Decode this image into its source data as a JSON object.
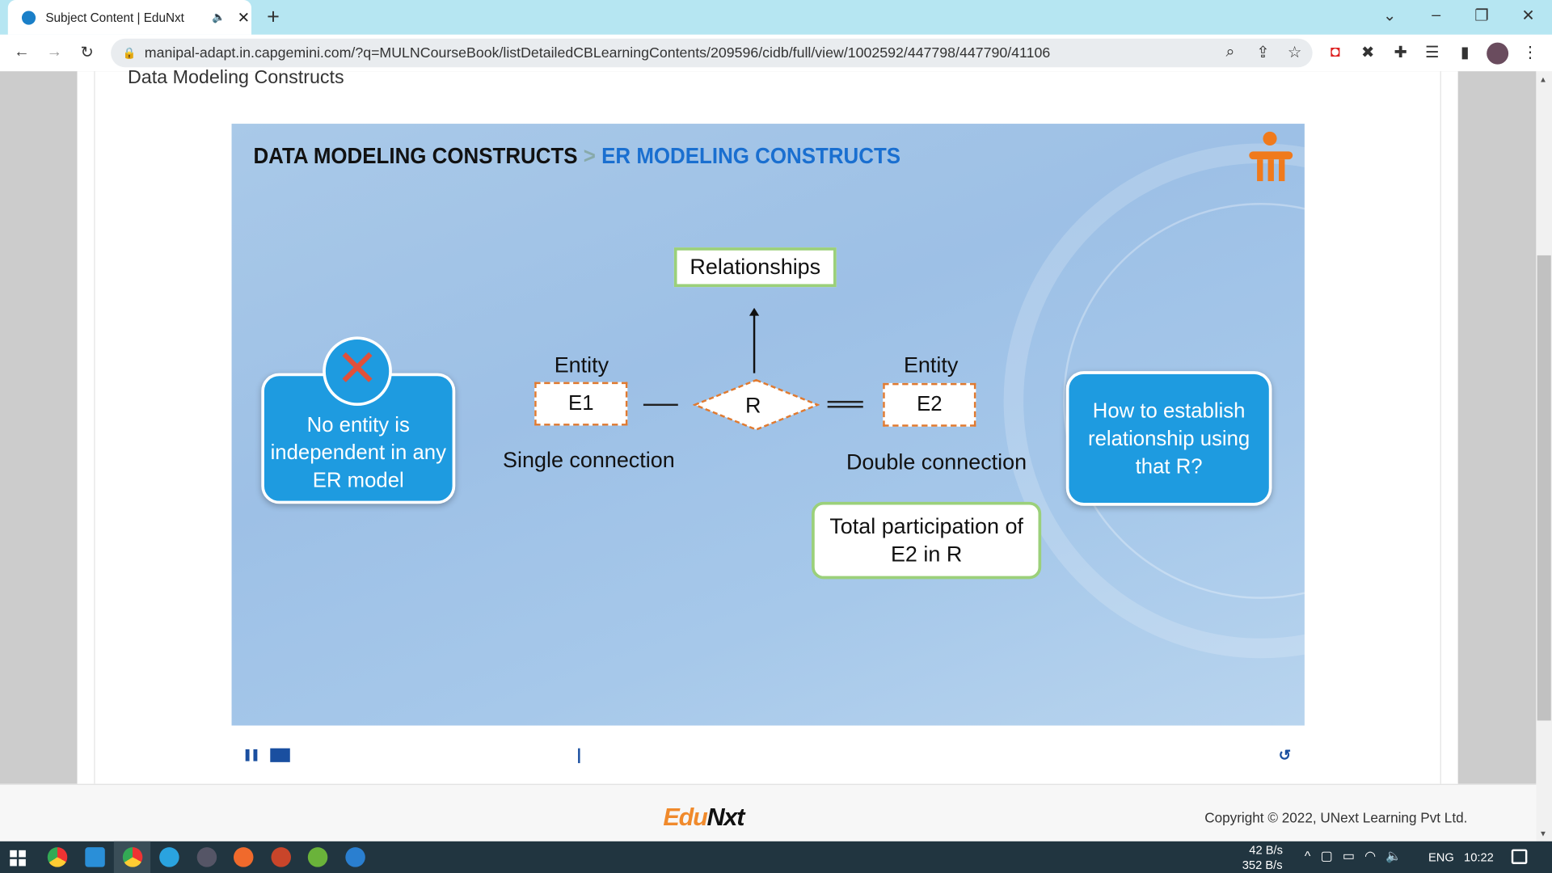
{
  "browser": {
    "tab_title": "Subject Content | EduNxt",
    "url": "manipal-adapt.in.capgemini.com/?q=MULNCourseBook/listDetailedCBLearningContents/209596/cidb/full/view/1002592/447798/447790/41106"
  },
  "page": {
    "heading": "Data Modeling Constructs"
  },
  "slide": {
    "breadcrumb_main": "DATA MODELING CONSTRUCTS",
    "breadcrumb_sep": ">",
    "breadcrumb_sub": "ER MODELING CONSTRUCTS",
    "left_note": "No entity is independent in any ER model",
    "relationships_label": "Relationships",
    "entity1_caption": "Entity",
    "entity1": "E1",
    "relationship": "R",
    "entity2_caption": "Entity",
    "entity2": "E2",
    "single_connection": "Single connection",
    "double_connection": "Double connection",
    "total_participation": "Total participation of E2 in R",
    "right_note": "How to establish relationship using that R?"
  },
  "player": {
    "progress_percent": 0
  },
  "footer": {
    "logo": "EduNxt",
    "copyright": "Copyright © 2022, UNext Learning Pvt Ltd."
  },
  "taskbar": {
    "net_up": "42 B/s",
    "net_down": "352 B/s",
    "lang": "ENG",
    "time": "10:22"
  },
  "colors": {
    "accent": "#1e9be0",
    "brand_orange": "#f08a2c",
    "player_blue": "#1a4fa0"
  }
}
